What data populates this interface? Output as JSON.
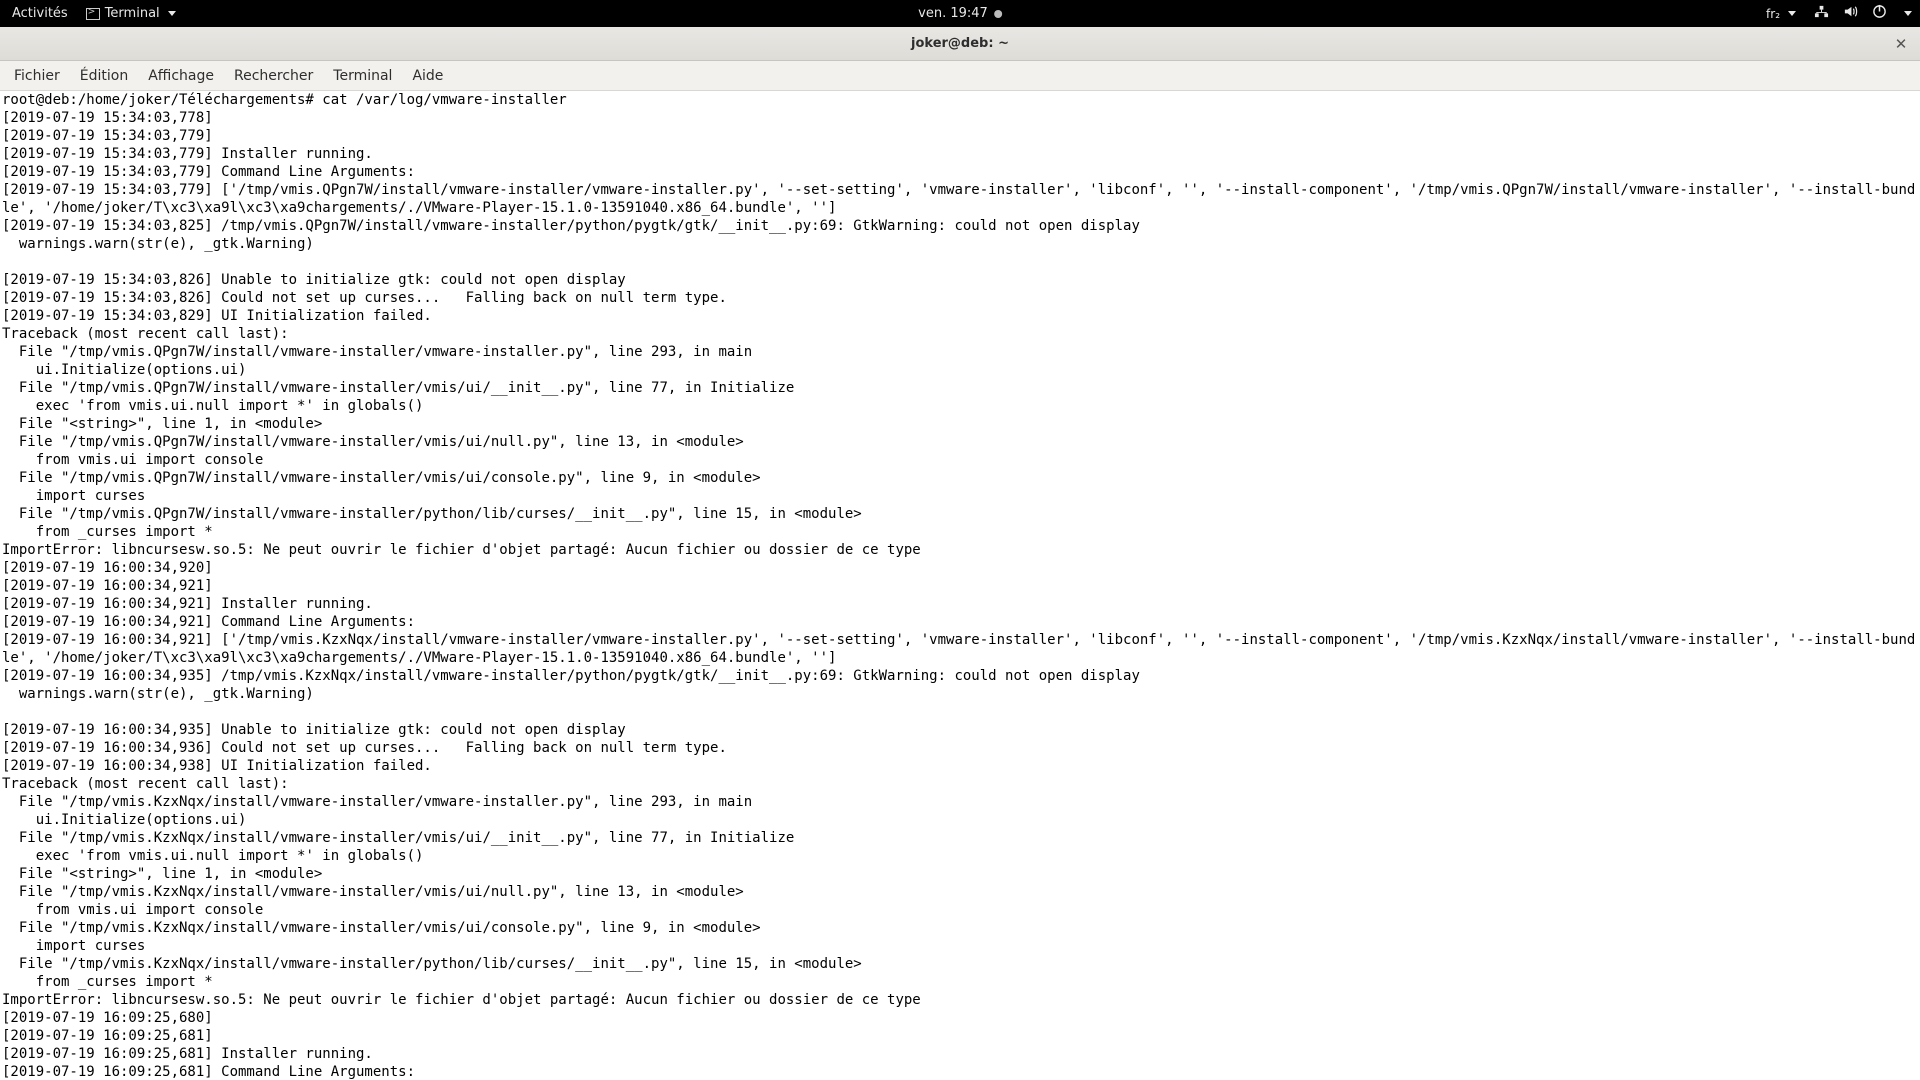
{
  "topbar": {
    "activities": "Activités",
    "app_label": "Terminal",
    "clock": "ven. 19:47",
    "keyboard": "fr₂"
  },
  "window": {
    "title": "joker@deb: ~"
  },
  "menu": {
    "file": "Fichier",
    "edit": "Édition",
    "view": "Affichage",
    "search": "Rechercher",
    "terminal": "Terminal",
    "help": "Aide"
  },
  "terminal": {
    "prompt": "root@deb:/home/joker/Téléchargements# cat /var/log/vmware-installer",
    "lines": [
      "[2019-07-19 15:34:03,778] ",
      "[2019-07-19 15:34:03,779] ",
      "[2019-07-19 15:34:03,779] Installer running.",
      "[2019-07-19 15:34:03,779] Command Line Arguments:",
      "[2019-07-19 15:34:03,779] ['/tmp/vmis.QPgn7W/install/vmware-installer/vmware-installer.py', '--set-setting', 'vmware-installer', 'libconf', '', '--install-component', '/tmp/vmis.QPgn7W/install/vmware-installer', '--install-bundle', '/home/joker/T\\xc3\\xa9l\\xc3\\xa9chargements/./VMware-Player-15.1.0-13591040.x86_64.bundle', '']",
      "[2019-07-19 15:34:03,825] /tmp/vmis.QPgn7W/install/vmware-installer/python/pygtk/gtk/__init__.py:69: GtkWarning: could not open display",
      "  warnings.warn(str(e), _gtk.Warning)",
      "",
      "[2019-07-19 15:34:03,826] Unable to initialize gtk: could not open display",
      "[2019-07-19 15:34:03,826] Could not set up curses...   Falling back on null term type.",
      "[2019-07-19 15:34:03,829] UI Initialization failed.",
      "Traceback (most recent call last):",
      "  File \"/tmp/vmis.QPgn7W/install/vmware-installer/vmware-installer.py\", line 293, in main",
      "    ui.Initialize(options.ui)",
      "  File \"/tmp/vmis.QPgn7W/install/vmware-installer/vmis/ui/__init__.py\", line 77, in Initialize",
      "    exec 'from vmis.ui.null import *' in globals()",
      "  File \"<string>\", line 1, in <module>",
      "  File \"/tmp/vmis.QPgn7W/install/vmware-installer/vmis/ui/null.py\", line 13, in <module>",
      "    from vmis.ui import console",
      "  File \"/tmp/vmis.QPgn7W/install/vmware-installer/vmis/ui/console.py\", line 9, in <module>",
      "    import curses",
      "  File \"/tmp/vmis.QPgn7W/install/vmware-installer/python/lib/curses/__init__.py\", line 15, in <module>",
      "    from _curses import *",
      "ImportError: libncursesw.so.5: Ne peut ouvrir le fichier d'objet partagé: Aucun fichier ou dossier de ce type",
      "[2019-07-19 16:00:34,920] ",
      "[2019-07-19 16:00:34,921] ",
      "[2019-07-19 16:00:34,921] Installer running.",
      "[2019-07-19 16:00:34,921] Command Line Arguments:",
      "[2019-07-19 16:00:34,921] ['/tmp/vmis.KzxNqx/install/vmware-installer/vmware-installer.py', '--set-setting', 'vmware-installer', 'libconf', '', '--install-component', '/tmp/vmis.KzxNqx/install/vmware-installer', '--install-bundle', '/home/joker/T\\xc3\\xa9l\\xc3\\xa9chargements/./VMware-Player-15.1.0-13591040.x86_64.bundle', '']",
      "[2019-07-19 16:00:34,935] /tmp/vmis.KzxNqx/install/vmware-installer/python/pygtk/gtk/__init__.py:69: GtkWarning: could not open display",
      "  warnings.warn(str(e), _gtk.Warning)",
      "",
      "[2019-07-19 16:00:34,935] Unable to initialize gtk: could not open display",
      "[2019-07-19 16:00:34,936] Could not set up curses...   Falling back on null term type.",
      "[2019-07-19 16:00:34,938] UI Initialization failed.",
      "Traceback (most recent call last):",
      "  File \"/tmp/vmis.KzxNqx/install/vmware-installer/vmware-installer.py\", line 293, in main",
      "    ui.Initialize(options.ui)",
      "  File \"/tmp/vmis.KzxNqx/install/vmware-installer/vmis/ui/__init__.py\", line 77, in Initialize",
      "    exec 'from vmis.ui.null import *' in globals()",
      "  File \"<string>\", line 1, in <module>",
      "  File \"/tmp/vmis.KzxNqx/install/vmware-installer/vmis/ui/null.py\", line 13, in <module>",
      "    from vmis.ui import console",
      "  File \"/tmp/vmis.KzxNqx/install/vmware-installer/vmis/ui/console.py\", line 9, in <module>",
      "    import curses",
      "  File \"/tmp/vmis.KzxNqx/install/vmware-installer/python/lib/curses/__init__.py\", line 15, in <module>",
      "    from _curses import *",
      "ImportError: libncursesw.so.5: Ne peut ouvrir le fichier d'objet partagé: Aucun fichier ou dossier de ce type",
      "[2019-07-19 16:09:25,680] ",
      "[2019-07-19 16:09:25,681] ",
      "[2019-07-19 16:09:25,681] Installer running.",
      "[2019-07-19 16:09:25,681] Command Line Arguments:"
    ]
  }
}
